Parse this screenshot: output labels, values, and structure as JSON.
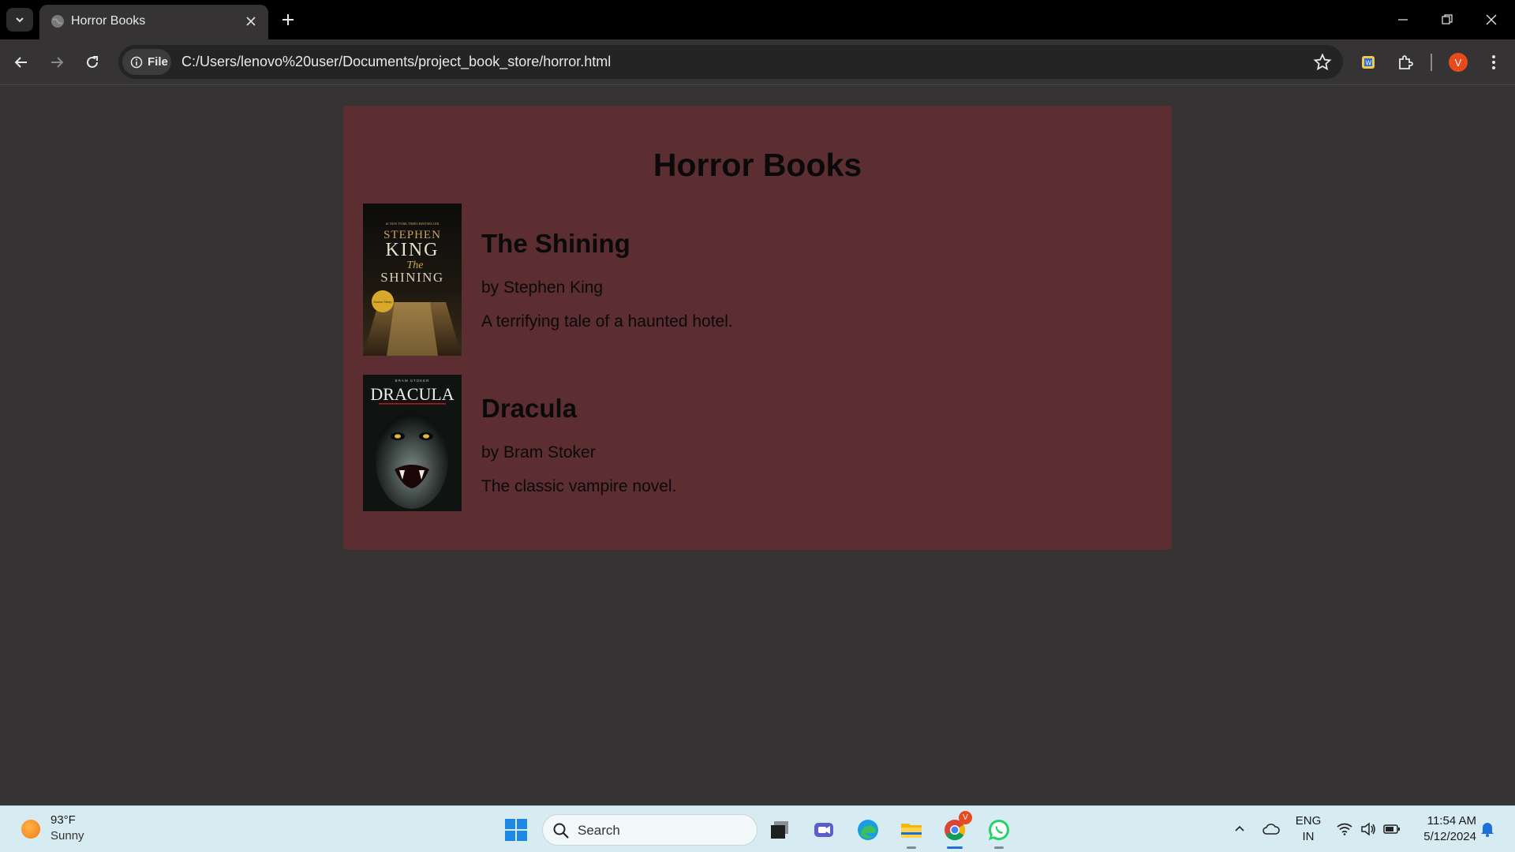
{
  "browser": {
    "tab_title": "Horror Books",
    "chip_label": "File",
    "url": "C:/Users/lenovo%20user/Documents/project_book_store/horror.html",
    "profile_initial": "V",
    "accent": "#e8491d"
  },
  "page": {
    "title": "Horror Books",
    "background": "#5c2e31",
    "books": [
      {
        "title": "The Shining",
        "author": "by Stephen King",
        "description": "A terrifying tale of a haunted hotel.",
        "cover": {
          "tagline": "#1 NEW YORK TIMES BESTSELLER",
          "author_line1": "STEPHEN",
          "author_line2": "KING",
          "title_script": "The",
          "title": "SHINING",
          "badge": "Doctor Sleep"
        }
      },
      {
        "title": "Dracula",
        "author": "by Bram Stoker",
        "description": "The classic vampire novel.",
        "cover": {
          "top_text": "BRAM STOKER",
          "title": "DRACULA"
        }
      }
    ]
  },
  "taskbar": {
    "weather_temp": "93°F",
    "weather_condition": "Sunny",
    "search_placeholder": "Search",
    "lang_line1": "ENG",
    "lang_line2": "IN",
    "time": "11:54 AM",
    "date": "5/12/2024",
    "chrome_badge": "V"
  }
}
